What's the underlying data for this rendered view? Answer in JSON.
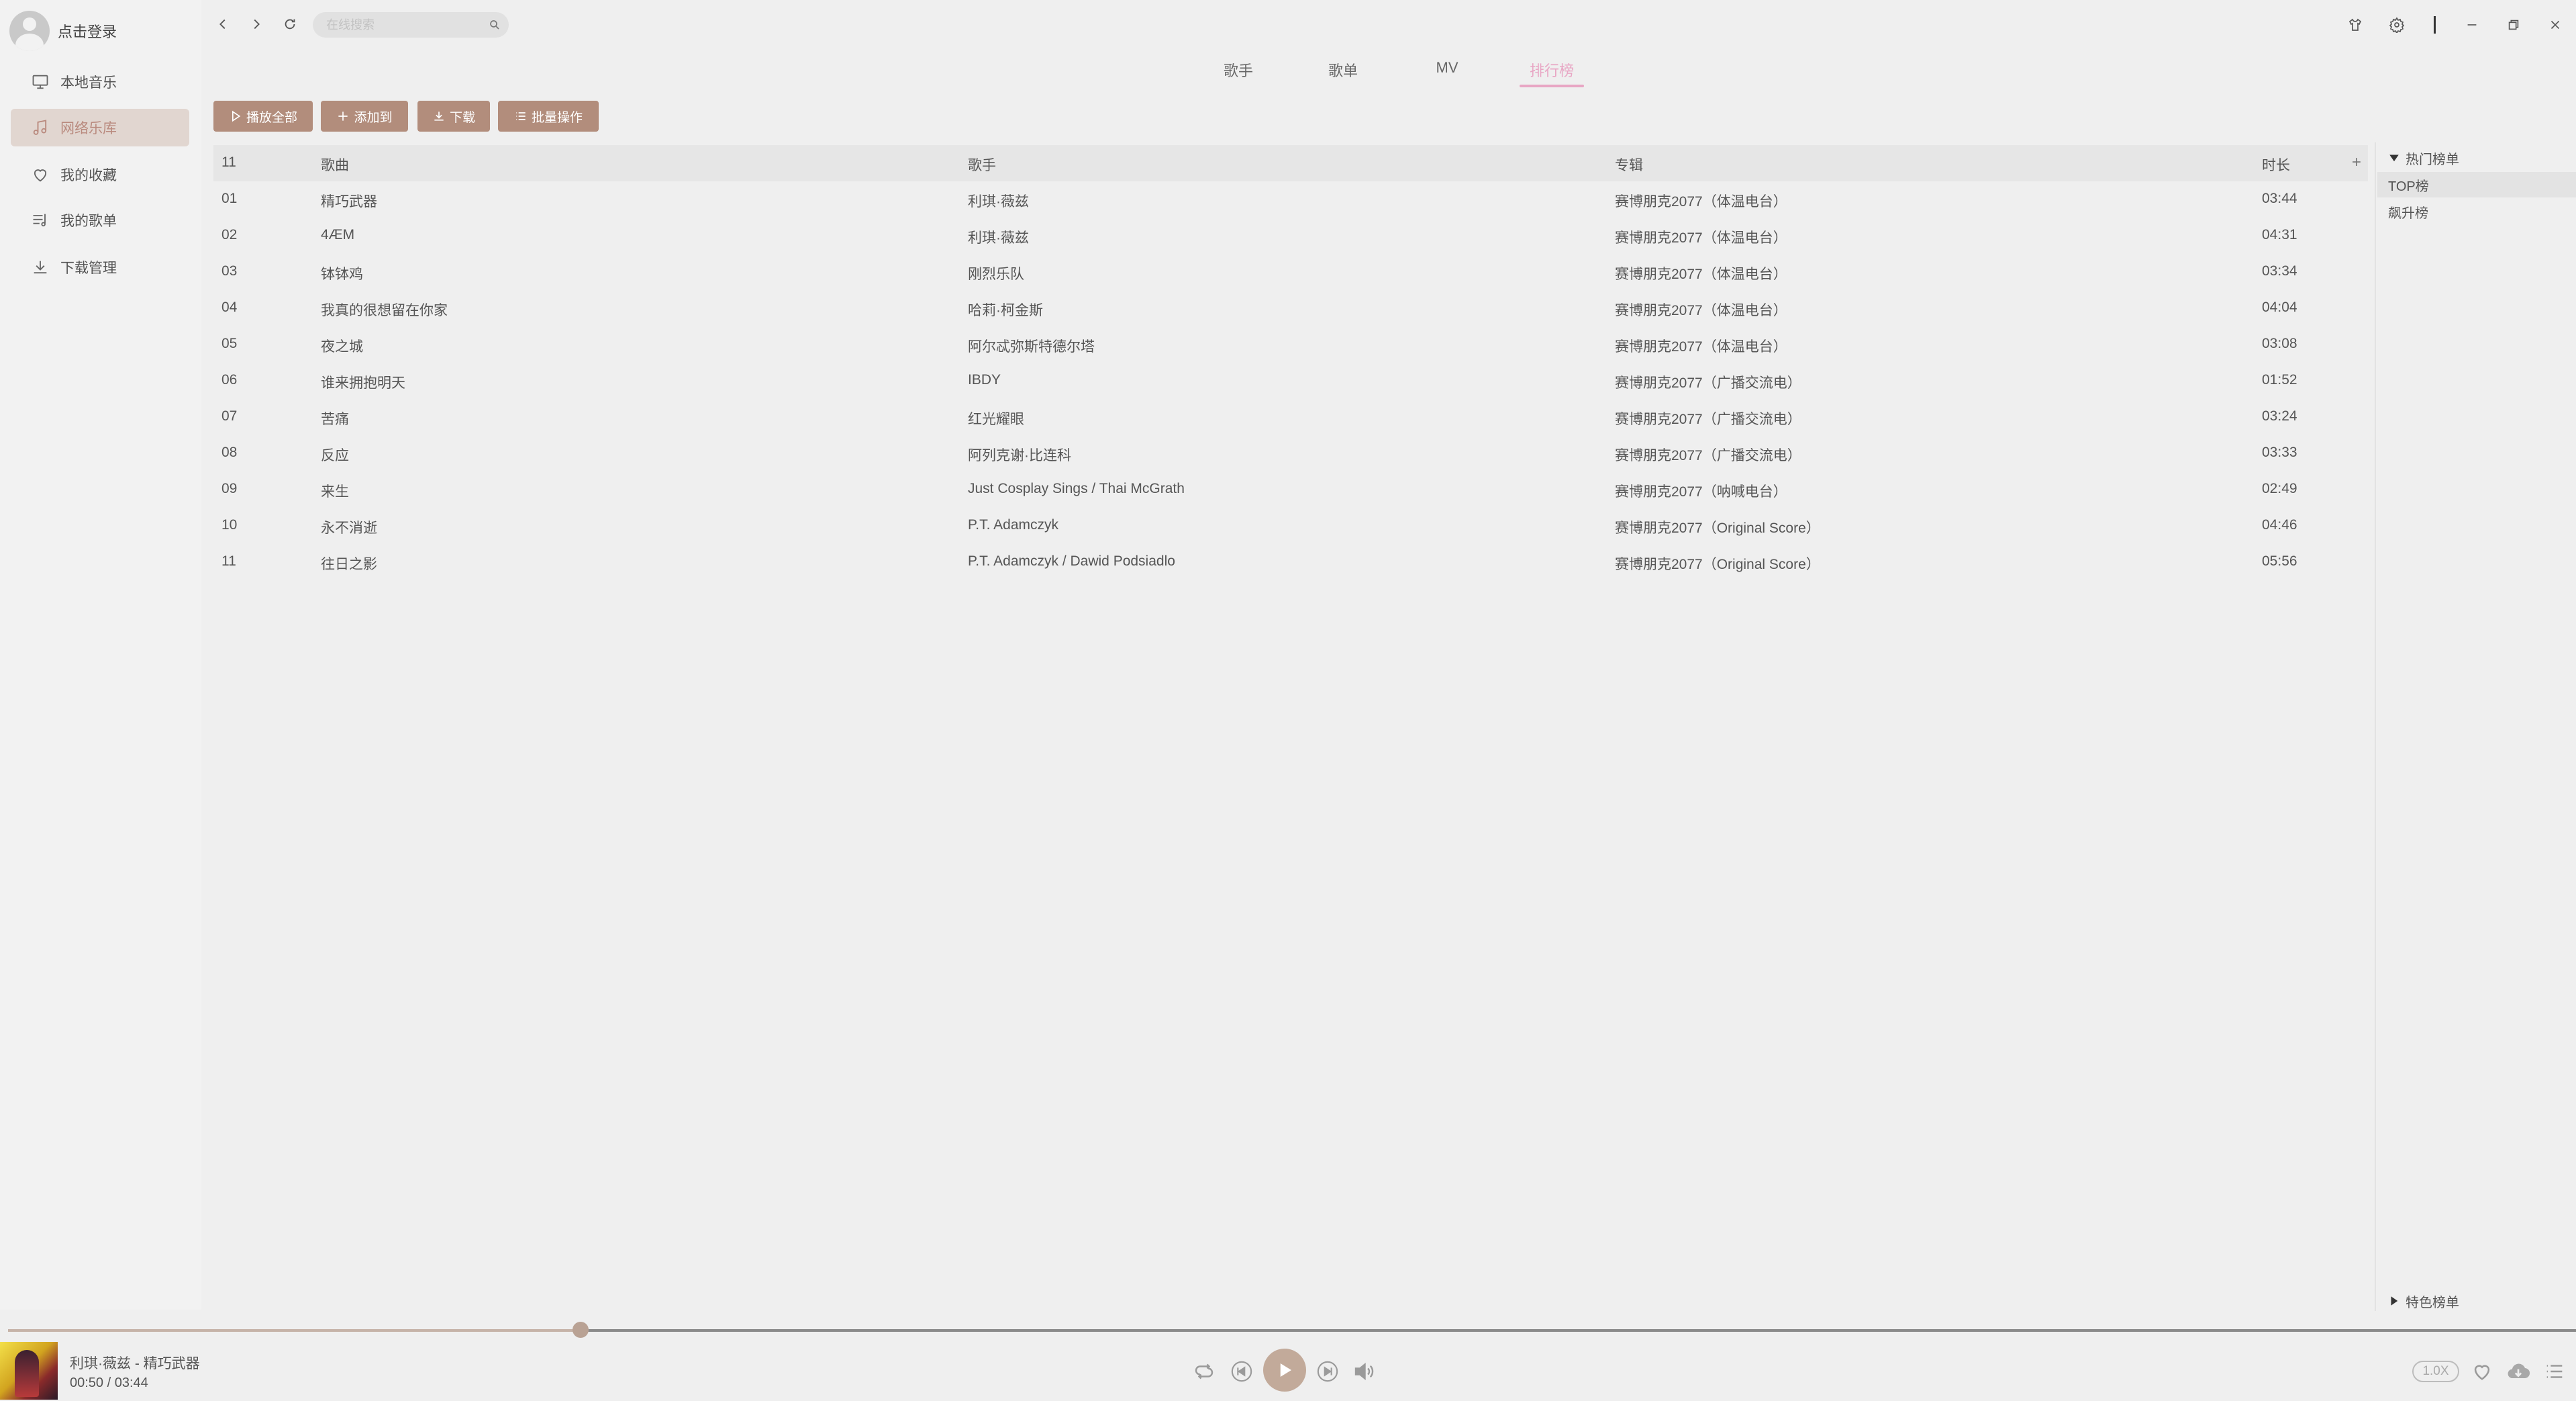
{
  "sidebar": {
    "login_label": "点击登录",
    "items": [
      {
        "label": "本地音乐",
        "icon": "monitor-icon",
        "active": false
      },
      {
        "label": "网络乐库",
        "icon": "music-note-icon",
        "active": true
      },
      {
        "label": "我的收藏",
        "icon": "heart-icon",
        "active": false
      },
      {
        "label": "我的歌单",
        "icon": "playlist-icon",
        "active": false
      },
      {
        "label": "下载管理",
        "icon": "download-icon",
        "active": false
      }
    ]
  },
  "search": {
    "placeholder": "在线搜索",
    "value": ""
  },
  "tabs": [
    {
      "label": "歌手",
      "active": false
    },
    {
      "label": "歌单",
      "active": false
    },
    {
      "label": "MV",
      "active": false
    },
    {
      "label": "排行榜",
      "active": true
    }
  ],
  "actions": {
    "play_all": "播放全部",
    "add_to": "添加到",
    "download": "下载",
    "batch": "批量操作"
  },
  "table": {
    "count": "11",
    "headers": {
      "title": "歌曲",
      "artist": "歌手",
      "album": "专辑",
      "duration": "时长"
    },
    "add_symbol": "+",
    "rows": [
      {
        "no": "01",
        "title": "精巧武器",
        "artist": "利琪·薇兹",
        "album": "赛博朋克2077（体温电台）",
        "duration": "03:44"
      },
      {
        "no": "02",
        "title": "4ÆM",
        "artist": "利琪·薇兹",
        "album": "赛博朋克2077（体温电台）",
        "duration": "04:31"
      },
      {
        "no": "03",
        "title": "钵钵鸡",
        "artist": "刚烈乐队",
        "album": "赛博朋克2077（体温电台）",
        "duration": "03:34"
      },
      {
        "no": "04",
        "title": "我真的很想留在你家",
        "artist": "哈莉·柯金斯",
        "album": "赛博朋克2077（体温电台）",
        "duration": "04:04"
      },
      {
        "no": "05",
        "title": "夜之城",
        "artist": "阿尔忒弥斯特德尔塔",
        "album": "赛博朋克2077（体温电台）",
        "duration": "03:08"
      },
      {
        "no": "06",
        "title": "谁来拥抱明天",
        "artist": "IBDY",
        "album": "赛博朋克2077（广播交流电）",
        "duration": "01:52"
      },
      {
        "no": "07",
        "title": "苦痛",
        "artist": "红光耀眼",
        "album": "赛博朋克2077（广播交流电）",
        "duration": "03:24"
      },
      {
        "no": "08",
        "title": "反应",
        "artist": "阿列克谢·比连科",
        "album": "赛博朋克2077（广播交流电）",
        "duration": "03:33"
      },
      {
        "no": "09",
        "title": "来生",
        "artist": "Just Cosplay Sings / Thai McGrath",
        "album": "赛博朋克2077（呐喊电台）",
        "duration": "02:49"
      },
      {
        "no": "10",
        "title": "永不消逝",
        "artist": "P.T. Adamczyk",
        "album": "赛博朋克2077（Original Score）",
        "duration": "04:46"
      },
      {
        "no": "11",
        "title": "往日之影",
        "artist": "P.T. Adamczyk / Dawid Podsiadlo",
        "album": "赛博朋克2077（Original Score）",
        "duration": "05:56"
      }
    ]
  },
  "right_panel": {
    "hot_header": "热门榜单",
    "hot_items": [
      {
        "label": "TOP榜",
        "active": true
      },
      {
        "label": "飙升榜",
        "active": false
      }
    ],
    "special_header": "特色榜单"
  },
  "player": {
    "track": "利琪·薇兹 - 精巧武器",
    "time": "00:50 / 03:44",
    "progress": 0.223,
    "speed": "1.0X"
  },
  "colors": {
    "accent": "#b28d7c",
    "tab_active": "#e8a6c4",
    "nav_active_bg": "#e1d6d0"
  }
}
